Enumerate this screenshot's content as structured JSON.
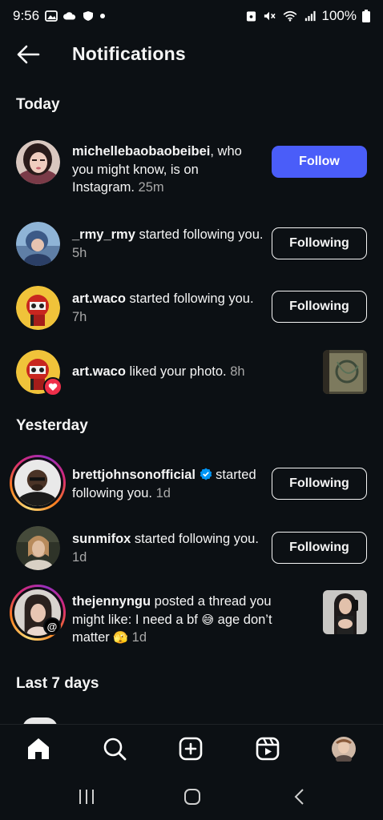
{
  "status_bar": {
    "time": "9:56",
    "battery": "100%"
  },
  "header": {
    "title": "Notifications"
  },
  "sections": {
    "today": "Today",
    "yesterday": "Yesterday",
    "last7": "Last 7 days"
  },
  "notifications": [
    {
      "username": "michellebaobaobeibei",
      "text": ", who you might know, is on Instagram.",
      "time": "25m",
      "action": "Follow"
    },
    {
      "username": "_rmy_rmy",
      "text": " started following you.",
      "time": "5h",
      "action": "Following"
    },
    {
      "username": "art.waco",
      "text": " started following you.",
      "time": "7h",
      "action": "Following"
    },
    {
      "username": "art.waco",
      "text": " liked your photo.",
      "time": "8h"
    },
    {
      "username": "brettjohnsonofficial",
      "text": " started following you.",
      "time": "1d",
      "action": "Following"
    },
    {
      "username": "sunmifox",
      "text": " started following you.",
      "time": "1d",
      "action": "Following"
    },
    {
      "username": "thejennyngu",
      "text_a": " posted a thread you might like: I need a bf ",
      "emoji_a": "😅",
      "text_b": " age don’t matter ",
      "emoji_b": "🫣",
      "time": "1d"
    }
  ],
  "colors": {
    "background": "#0c1014",
    "follow_blue": "#4a5df9",
    "verified_blue": "#0095f6",
    "heart_red": "#ef2f4a",
    "secondary_text": "#a8a8a8"
  },
  "icons": {
    "back": "arrow-left-icon",
    "home": "home-icon",
    "search": "search-icon",
    "create": "plus-square-icon",
    "reels": "reels-icon",
    "profile": "profile-avatar"
  }
}
